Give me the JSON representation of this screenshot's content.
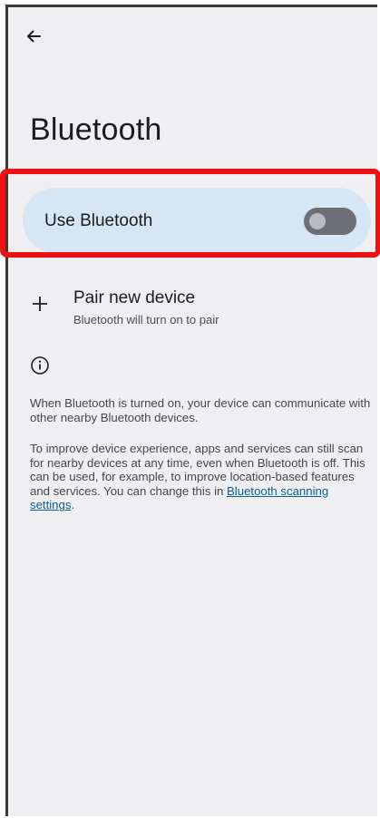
{
  "header": {
    "back_icon": "arrow-back-icon",
    "title": "Bluetooth"
  },
  "use_bluetooth": {
    "label": "Use Bluetooth",
    "toggle_state": "off"
  },
  "pair_device": {
    "icon": "plus-icon",
    "title": "Pair new device",
    "subtitle": "Bluetooth will turn on to pair"
  },
  "info": {
    "icon": "info-icon",
    "paragraph1": "When Bluetooth is turned on, your device can communicate with other nearby Bluetooth devices.",
    "paragraph2_text": "To improve device experience, apps and services can still scan for nearby devices at any time, even when Bluetooth is off. This can be used, for example, to improve location-based features and services. You can change this in",
    "paragraph2_link": "Bluetooth scanning settings",
    "paragraph2_end": "."
  },
  "colors": {
    "highlight": "#ee1111",
    "row_background": "#d6e6f5",
    "toggle_track_off": "#6d6f74",
    "link": "#0b5e96",
    "screen_background": "#efeff2"
  }
}
